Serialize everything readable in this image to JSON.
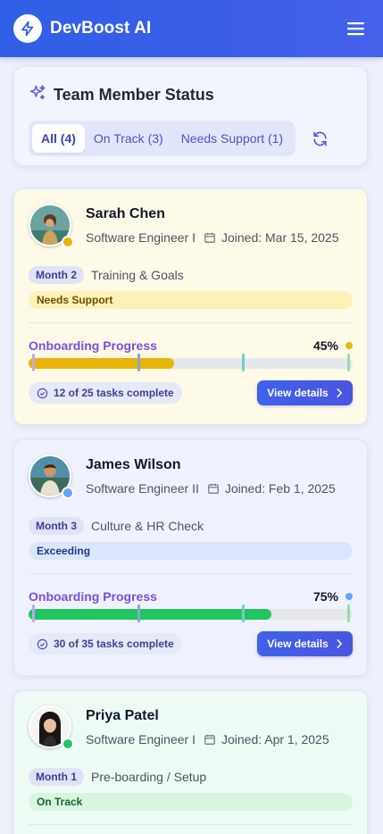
{
  "app": {
    "title": "DevBoost AI"
  },
  "status_panel": {
    "title": "Team Member Status",
    "filters": [
      "All (4)",
      "On Track (3)",
      "Needs Support (1)"
    ],
    "active_filter": 0
  },
  "members": [
    {
      "name": "Sarah Chen",
      "role": "Software Engineer I",
      "joined": "Joined: Mar 15, 2025",
      "month": "Month 2",
      "phase": "Training & Goals",
      "state": "Needs Support",
      "progress_label": "Onboarding Progress",
      "progress_text": "45%",
      "progress": 0.45,
      "tasks": "12 of 25 tasks complete",
      "button": "View details",
      "colors": {
        "card": "#fefae8",
        "fill": "#eab308",
        "dot": "#eab308",
        "state_bg": "#fdf1b7",
        "state_text": "#6b4e0a"
      }
    },
    {
      "name": "James Wilson",
      "role": "Software Engineer II",
      "joined": "Joined: Feb 1, 2025",
      "month": "Month 3",
      "phase": "Culture & HR Check",
      "state": "Exceeding",
      "progress_label": "Onboarding Progress",
      "progress_text": "75%",
      "progress": 0.75,
      "tasks": "30 of 35 tasks complete",
      "button": "View details",
      "colors": {
        "card": "#eff2fd",
        "fill": "#22c55e",
        "dot": "#60a5fa",
        "state_bg": "#dbe6fc",
        "state_text": "#1f3a8a"
      }
    },
    {
      "name": "Priya Patel",
      "role": "Software Engineer I",
      "joined": "Joined: Apr 1, 2025",
      "month": "Month 1",
      "phase": "Pre-boarding / Setup",
      "state": "On Track",
      "colors": {
        "card": "#eefbf5",
        "fill": "#22c55e",
        "dot": "#22c55e",
        "state_bg": "#d8f5e2",
        "state_text": "#166534"
      }
    }
  ],
  "icons": {
    "logo": "lightning-bolt-icon",
    "menu": "hamburger-menu-icon",
    "title": "sparkles-icon",
    "refresh": "refresh-icon",
    "calendar": "calendar-icon",
    "check": "check-circle-icon",
    "chevron": "chevron-right-icon"
  }
}
